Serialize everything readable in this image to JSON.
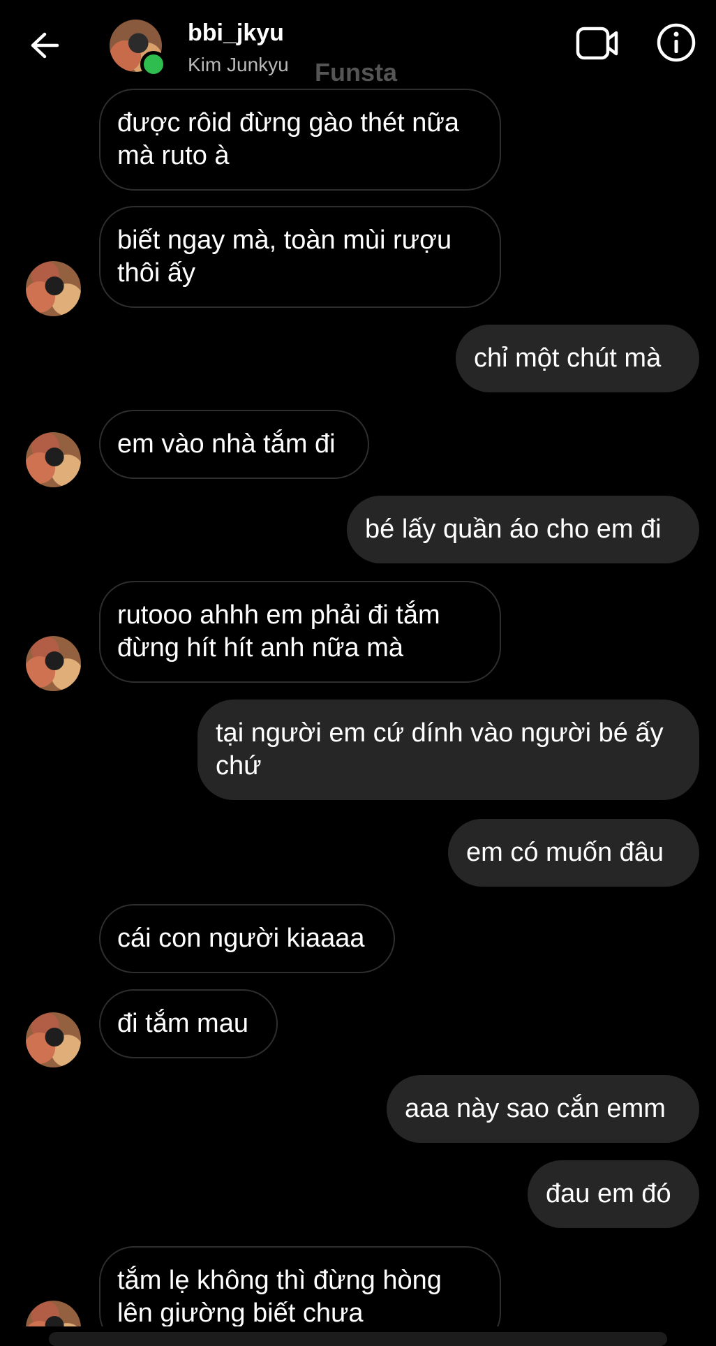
{
  "header": {
    "username": "bbi_jkyu",
    "full_name": "Kim Junkyu",
    "tag": "Funsta",
    "icons": {
      "back": "arrow-left-icon",
      "video": "video-camera-icon",
      "info": "info-icon"
    },
    "online_color": "#2fbd4f"
  },
  "messages": [
    {
      "sender": "them",
      "text": "được rôid đừng gào thét nữa mà ruto à"
    },
    {
      "sender": "them",
      "text": "biết ngay mà, toàn mùi rượu thôi ấy"
    },
    {
      "sender": "me",
      "text": "chỉ một chút mà"
    },
    {
      "sender": "them",
      "text": "em vào nhà tắm đi"
    },
    {
      "sender": "me",
      "text": "bé lấy quần áo cho em đi"
    },
    {
      "sender": "them",
      "text": "rutooo ahhh em phải đi tắm đừng hít hít anh nữa mà"
    },
    {
      "sender": "me",
      "text": "tại người em cứ dính vào người bé ấy chứ"
    },
    {
      "sender": "me",
      "text": "em có muốn đâu"
    },
    {
      "sender": "them",
      "text": "cái con người kiaaaa"
    },
    {
      "sender": "them",
      "text": "đi tắm mau"
    },
    {
      "sender": "me",
      "text": "aaa này sao cắn emm"
    },
    {
      "sender": "me",
      "text": "đau em đó"
    },
    {
      "sender": "them",
      "text": "tắm lẹ không thì đừng hòng lên giường biết chưa"
    }
  ]
}
